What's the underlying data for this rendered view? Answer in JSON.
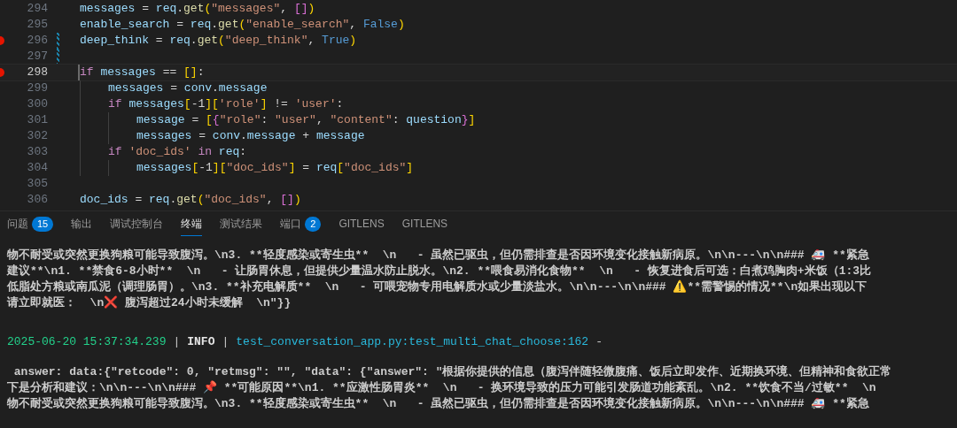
{
  "editor": {
    "lines": [
      {
        "number": "294",
        "breakpoint": false,
        "current": false,
        "modified": false,
        "tokens": [
          {
            "kind": "var",
            "text": "messages"
          },
          {
            "kind": "op",
            "text": " = "
          },
          {
            "kind": "var",
            "text": "req"
          },
          {
            "kind": "op",
            "text": "."
          },
          {
            "kind": "func",
            "text": "get"
          },
          {
            "kind": "bracket1",
            "text": "("
          },
          {
            "kind": "str",
            "text": "\"messages\""
          },
          {
            "kind": "op",
            "text": ", "
          },
          {
            "kind": "bracket2",
            "text": "[]"
          },
          {
            "kind": "bracket1",
            "text": ")"
          }
        ]
      },
      {
        "number": "295",
        "breakpoint": false,
        "current": false,
        "modified": false,
        "tokens": [
          {
            "kind": "var",
            "text": "enable_search"
          },
          {
            "kind": "op",
            "text": " = "
          },
          {
            "kind": "var",
            "text": "req"
          },
          {
            "kind": "op",
            "text": "."
          },
          {
            "kind": "func",
            "text": "get"
          },
          {
            "kind": "bracket1",
            "text": "("
          },
          {
            "kind": "str",
            "text": "\"enable_search\""
          },
          {
            "kind": "op",
            "text": ", "
          },
          {
            "kind": "const",
            "text": "False"
          },
          {
            "kind": "bracket1",
            "text": ")"
          }
        ]
      },
      {
        "number": "296",
        "breakpoint": true,
        "current": false,
        "modified": true,
        "tokens": [
          {
            "kind": "var",
            "text": "deep_think"
          },
          {
            "kind": "op",
            "text": " = "
          },
          {
            "kind": "var",
            "text": "req"
          },
          {
            "kind": "op",
            "text": "."
          },
          {
            "kind": "func",
            "text": "get"
          },
          {
            "kind": "bracket1",
            "text": "("
          },
          {
            "kind": "str",
            "text": "\"deep_think\""
          },
          {
            "kind": "op",
            "text": ", "
          },
          {
            "kind": "const",
            "text": "True"
          },
          {
            "kind": "bracket1",
            "text": ")"
          }
        ]
      },
      {
        "number": "297",
        "breakpoint": false,
        "current": false,
        "modified": true
      },
      {
        "number": "298",
        "breakpoint": true,
        "current": true,
        "modified": false,
        "tokens": [
          {
            "kind": "keyword",
            "text": "if "
          },
          {
            "kind": "var",
            "text": "messages"
          },
          {
            "kind": "op",
            "text": " == "
          },
          {
            "kind": "bracket1",
            "text": "[]"
          },
          {
            "kind": "op",
            "text": ":"
          }
        ],
        "children": [
          {
            "number": "299",
            "breakpoint": false,
            "current": false,
            "modified": false,
            "tokens": [
              {
                "kind": "var",
                "text": "messages"
              },
              {
                "kind": "op",
                "text": " = "
              },
              {
                "kind": "var",
                "text": "conv"
              },
              {
                "kind": "op",
                "text": "."
              },
              {
                "kind": "var",
                "text": "message"
              }
            ]
          },
          {
            "number": "300",
            "breakpoint": false,
            "current": false,
            "modified": false,
            "tokens": [
              {
                "kind": "keyword",
                "text": "if "
              },
              {
                "kind": "var",
                "text": "messages"
              },
              {
                "kind": "bracket1",
                "text": "["
              },
              {
                "kind": "op",
                "text": "-1"
              },
              {
                "kind": "bracket1",
                "text": "]["
              },
              {
                "kind": "str",
                "text": "'role'"
              },
              {
                "kind": "bracket1",
                "text": "]"
              },
              {
                "kind": "op",
                "text": " != "
              },
              {
                "kind": "str",
                "text": "'user'"
              },
              {
                "kind": "op",
                "text": ":"
              }
            ],
            "children": [
              {
                "number": "301",
                "breakpoint": false,
                "current": false,
                "modified": false,
                "tokens": [
                  {
                    "kind": "var",
                    "text": "message"
                  },
                  {
                    "kind": "op",
                    "text": " = "
                  },
                  {
                    "kind": "bracket1",
                    "text": "["
                  },
                  {
                    "kind": "bracket2",
                    "text": "{"
                  },
                  {
                    "kind": "str",
                    "text": "\"role\""
                  },
                  {
                    "kind": "op",
                    "text": ": "
                  },
                  {
                    "kind": "str",
                    "text": "\"user\""
                  },
                  {
                    "kind": "op",
                    "text": ", "
                  },
                  {
                    "kind": "str",
                    "text": "\"content\""
                  },
                  {
                    "kind": "op",
                    "text": ": "
                  },
                  {
                    "kind": "var",
                    "text": "question"
                  },
                  {
                    "kind": "bracket2",
                    "text": "}"
                  },
                  {
                    "kind": "bracket1",
                    "text": "]"
                  }
                ]
              },
              {
                "number": "302",
                "breakpoint": false,
                "current": false,
                "modified": false,
                "tokens": [
                  {
                    "kind": "var",
                    "text": "messages"
                  },
                  {
                    "kind": "op",
                    "text": " = "
                  },
                  {
                    "kind": "var",
                    "text": "conv"
                  },
                  {
                    "kind": "op",
                    "text": "."
                  },
                  {
                    "kind": "var",
                    "text": "message"
                  },
                  {
                    "kind": "op",
                    "text": " + "
                  },
                  {
                    "kind": "var",
                    "text": "message"
                  }
                ]
              }
            ]
          },
          {
            "number": "303",
            "breakpoint": false,
            "current": false,
            "modified": false,
            "tokens": [
              {
                "kind": "keyword",
                "text": "if "
              },
              {
                "kind": "str",
                "text": "'doc_ids'"
              },
              {
                "kind": "keyword",
                "text": " in "
              },
              {
                "kind": "var",
                "text": "req"
              },
              {
                "kind": "op",
                "text": ":"
              }
            ],
            "children": [
              {
                "number": "304",
                "breakpoint": false,
                "current": false,
                "modified": false,
                "tokens": [
                  {
                    "kind": "var",
                    "text": "messages"
                  },
                  {
                    "kind": "bracket1",
                    "text": "["
                  },
                  {
                    "kind": "op",
                    "text": "-1"
                  },
                  {
                    "kind": "bracket1",
                    "text": "]["
                  },
                  {
                    "kind": "str",
                    "text": "\"doc_ids\""
                  },
                  {
                    "kind": "bracket1",
                    "text": "]"
                  },
                  {
                    "kind": "op",
                    "text": " = "
                  },
                  {
                    "kind": "var",
                    "text": "req"
                  },
                  {
                    "kind": "bracket1",
                    "text": "["
                  },
                  {
                    "kind": "str",
                    "text": "\"doc_ids\""
                  },
                  {
                    "kind": "bracket1",
                    "text": "]"
                  }
                ]
              }
            ]
          }
        ]
      },
      {
        "number": "305",
        "breakpoint": false,
        "current": false,
        "modified": false
      },
      {
        "number": "306",
        "breakpoint": false,
        "current": false,
        "modified": false,
        "tokens": [
          {
            "kind": "var",
            "text": "doc_ids"
          },
          {
            "kind": "op",
            "text": " = "
          },
          {
            "kind": "var",
            "text": "req"
          },
          {
            "kind": "op",
            "text": "."
          },
          {
            "kind": "func",
            "text": "get"
          },
          {
            "kind": "bracket1",
            "text": "("
          },
          {
            "kind": "str",
            "text": "\"doc_ids\""
          },
          {
            "kind": "op",
            "text": ", "
          },
          {
            "kind": "bracket2",
            "text": "[]"
          },
          {
            "kind": "bracket1",
            "text": ")"
          }
        ]
      }
    ]
  },
  "panel": {
    "tabs": [
      {
        "label": "问题",
        "badge": "15",
        "selected": false
      },
      {
        "label": "输出",
        "selected": false
      },
      {
        "label": "调试控制台",
        "selected": false
      },
      {
        "label": "终端",
        "selected": true
      },
      {
        "label": "测试结果",
        "selected": false
      },
      {
        "label": "端口",
        "badge": "2",
        "selected": false
      },
      {
        "label": "GITLENS",
        "selected": false
      },
      {
        "label": "GITLENS",
        "selected": false
      }
    ]
  },
  "terminal": {
    "blocks": [
      {
        "kind": "output",
        "lines": [
          "物不耐受或突然更换狗粮可能导致腹泻。\\n3. **轻度感染或寄生虫**  \\n   - 虽然已驱虫，但仍需排查是否因环境变化接触新病原。\\n\\n---\\n\\n### 🚑 **紧急",
          "建议**\\n1. **禁食6-8小时**  \\n   - 让肠胃休息，但提供少量温水防止脱水。\\n2. **喂食易消化食物**  \\n   - 恢复进食后可选：白煮鸡胸肉+米饭（1:3比",
          "低脂处方粮或南瓜泥（调理肠胃）。\\n3. **补充电解质**  \\n   - 可喂宠物专用电解质水或少量淡盐水。\\n\\n---\\n\\n### ⚠️**需警惕的情况**\\n如果出现以下",
          "请立即就医：  \\n❌ 腹泻超过24小时未缓解  \\n\"}}"
        ]
      },
      {
        "kind": "log",
        "tokens": [
          {
            "kind": "time",
            "text": "2025-06-20 15:37:34.239"
          },
          {
            "kind": "separator",
            "text": "|"
          },
          {
            "kind": "level",
            "text": "INFO"
          },
          {
            "kind": "separator",
            "text": "|"
          },
          {
            "kind": "source",
            "text": "test_conversation_app.py:test_multi_chat_choose:162"
          },
          {
            "kind": "separator",
            "text": "-"
          }
        ]
      },
      {
        "kind": "output",
        "lines": [
          " answer: data:{\"retcode\": 0, \"retmsg\": \"\", \"data\": {\"answer\": \"根据你提供的信息（腹泻伴随轻微腹痛、饭后立即发作、近期换环境、但精神和食欲正常",
          "下是分析和建议：\\n\\n---\\n\\n### 📌 **可能原因**\\n1. **应激性肠胃炎**  \\n   - 换环境导致的压力可能引发肠道功能紊乱。\\n2. **饮食不当/过敏**  \\n",
          "物不耐受或突然更换狗粮可能导致腹泻。\\n3. **轻度感染或寄生虫**  \\n   - 虽然已驱虫，但仍需排查是否因环境变化接触新病原。\\n\\n---\\n\\n### 🚑 **紧急"
        ]
      }
    ]
  }
}
